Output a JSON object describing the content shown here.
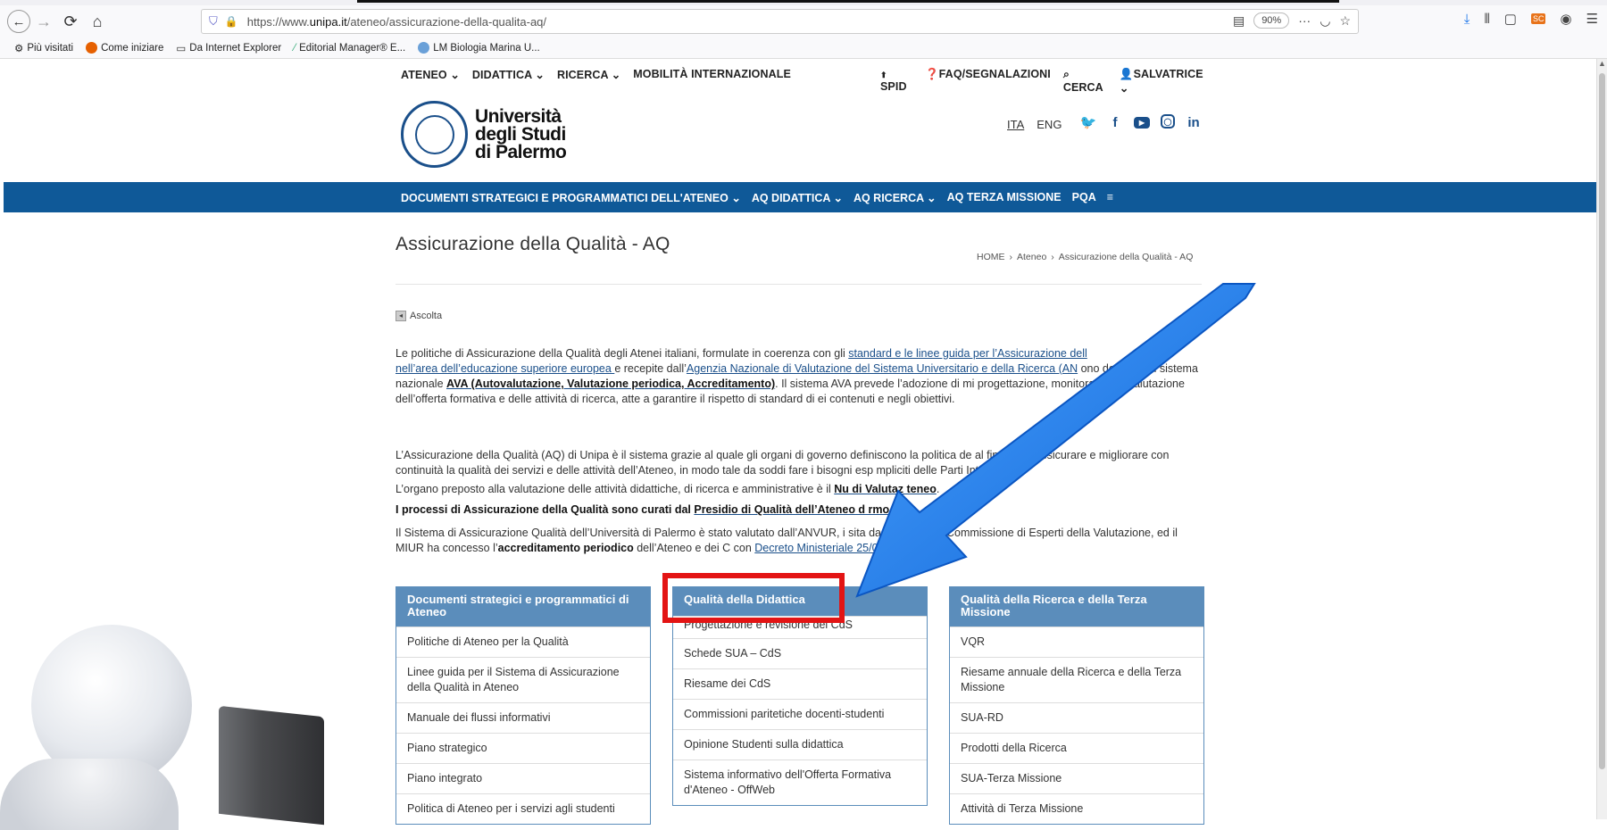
{
  "browser": {
    "url_prefix": "https://www.",
    "url_host": "unipa.it",
    "url_path": "/ateneo/assicurazione-della-qualita-aq/",
    "zoom": "90%",
    "bookmarks": [
      {
        "label": "Più visitati",
        "icon": "gear-icon"
      },
      {
        "label": "Come iniziare",
        "icon": "firefox-icon"
      },
      {
        "label": "Da Internet Explorer",
        "icon": "folder-icon"
      },
      {
        "label": "Editorial Manager® E...",
        "icon": "em-icon"
      },
      {
        "label": "LM Biologia Marina U...",
        "icon": "globe-icon"
      }
    ]
  },
  "topnav": {
    "ateneo": "ATENEO",
    "didattica": "DIDATTICA",
    "ricerca": "RICERCA",
    "mobilita": "MOBILITÀ INTERNAZIONALE",
    "spid": "SPID",
    "faq": "FAQ/SEGNALAZIONI",
    "cerca": "CERCA",
    "user": "SALVATRICE"
  },
  "logo": {
    "line1": "Università",
    "line2": "degli Studi",
    "line3": "di Palermo"
  },
  "lang": {
    "ita": "ITA",
    "eng": "ENG"
  },
  "bluebar": {
    "items": [
      "DOCUMENTI STRATEGICI E PROGRAMMATICI DELL'ATENEO",
      "AQ DIDATTICA",
      "AQ RICERCA",
      "AQ TERZA MISSIONE",
      "PQA"
    ]
  },
  "page": {
    "title": "Assicurazione della Qualità - AQ",
    "breadcrumb": [
      "HOME",
      "Ateneo",
      "Assicurazione della Qualità - AQ"
    ],
    "ascolta": "Ascolta"
  },
  "paragraphs": {
    "p1_a": "Le politiche di Assicurazione della Qualità degli Atenei italiani,  formulate in coerenza con gli ",
    "p1_link1": "standard e le linee guida per l’Assicurazione dell",
    "p1_link1b": "nell’area dell’educazione superiore europea ",
    "p1_b": " e recepite dall’",
    "p1_link2": "Agenzia Nazionale di Valutazione del Sistema Universitario e della Ricerca (AN",
    "p1_c": "ono definite dal sistema nazionale ",
    "p1_link3": "AVA (Autovalutazione, Valutazione periodica, Accreditamento)",
    "p1_d": ". Il sistema AVA prevede l’adozione di mi progettazione, monitoraggio e valutazione dell’offerta formativa e delle attività di ricerca, atte a garantire il rispetto di standard di ei contenuti e negli obiettivi.",
    "p2": "L’Assicurazione della Qualità (AQ) di Unipa è il sistema grazie al quale gli organi di governo definiscono la politica de al fine di ad assicurare e migliorare con continuità la qualità dei servizi e delle attività dell’Ateneo, in modo tale da soddi fare i bisogni esp mpliciti delle Parti Interessate.",
    "p3_a": "L’organo preposto alla valutazione delle attività didattiche, di ricerca e amministrative è il ",
    "p3_link": "Nu di Valutaz teneo",
    "p4_a": "I processi di Assicurazione della Qualità sono curati dal ",
    "p4_link": "Presidio di Qualità dell’Ateneo d rmo",
    "p5_a": "Il Sistema di Assicurazione Qualità dell’Università di Palermo è stato valutato dall’ANVUR, i sita da parte di una Commissione di Esperti della Valutazione, ed il MIUR ha concesso l’",
    "p5_b": "accreditamento periodico",
    "p5_c": " dell’Ateneo e dei C con ",
    "p5_link": "Decreto Ministeriale 25/02/2019"
  },
  "boxes": {
    "left": {
      "title": "Documenti strategici e programmatici di Ateneo",
      "items": [
        "Politiche di Ateneo per la Qualità",
        "Linee guida per il Sistema di Assicurazione della Qualità in Ateneo",
        "Manuale dei flussi informativi",
        "Piano strategico",
        "Piano integrato",
        "Politica di Ateneo per i servizi agli studenti"
      ]
    },
    "mid": {
      "title": "Qualità della Didattica",
      "items": [
        "Progettazione e revisione dei CdS",
        "Schede SUA – CdS",
        "Riesame dei CdS",
        "Commissioni paritetiche docenti-studenti",
        "Opinione Studenti sulla didattica",
        "Sistema informativo dell'Offerta Formativa d'Ateneo - OffWeb"
      ]
    },
    "right": {
      "title": "Qualità della Ricerca e della Terza Missione",
      "items": [
        "VQR",
        "Riesame annuale della Ricerca e della Terza Missione",
        "SUA-RD",
        "Prodotti della Ricerca",
        "SUA-Terza Missione",
        "Attività di Terza Missione"
      ]
    }
  },
  "colors": {
    "brand_blue": "#0f5998",
    "box_header": "#5b8dbb",
    "highlight_red": "#e31414",
    "arrow_blue": "#1877e8"
  }
}
